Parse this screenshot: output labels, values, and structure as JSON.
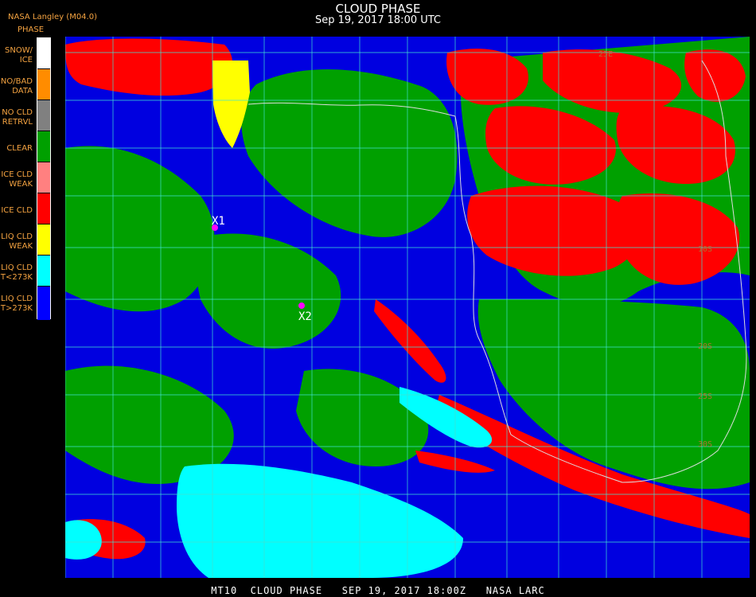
{
  "header": {
    "title": "CLOUD PHASE",
    "subtitle": "Sep 19, 2017 18:00 UTC",
    "org": "NASA Langley (M04.0)"
  },
  "legend": {
    "title": "PHASE",
    "items": [
      {
        "lines": [
          "SNOW/",
          "ICE"
        ],
        "color": "#ffffff"
      },
      {
        "lines": [
          "NO/BAD",
          "DATA"
        ],
        "color": "#ff8c00"
      },
      {
        "lines": [
          "NO CLD",
          "RETRVL"
        ],
        "color": "#808080"
      },
      {
        "lines": [
          "CLEAR"
        ],
        "color": "#00a000"
      },
      {
        "lines": [
          "ICE CLD",
          "WEAK"
        ],
        "color": "#ff8080"
      },
      {
        "lines": [
          "ICE CLD"
        ],
        "color": "#ff0000"
      },
      {
        "lines": [
          "LIQ CLD",
          "WEAK"
        ],
        "color": "#ffff00"
      },
      {
        "lines": [
          "LIQ CLD",
          "T<273K"
        ],
        "color": "#00ffff"
      },
      {
        "lines": [
          "LIQ CLD",
          "T>273K"
        ],
        "color": "#0000ff"
      }
    ]
  },
  "markers": [
    {
      "label": "X1",
      "color": "#ff00ff"
    },
    {
      "label": "X2",
      "color": "#ff00ff"
    }
  ],
  "grid_labels": [
    "25E",
    "10S",
    "20S",
    "25S",
    "30S"
  ],
  "footer": "MT10  CLOUD PHASE   SEP 19, 2017 18:00Z   NASA LARC"
}
